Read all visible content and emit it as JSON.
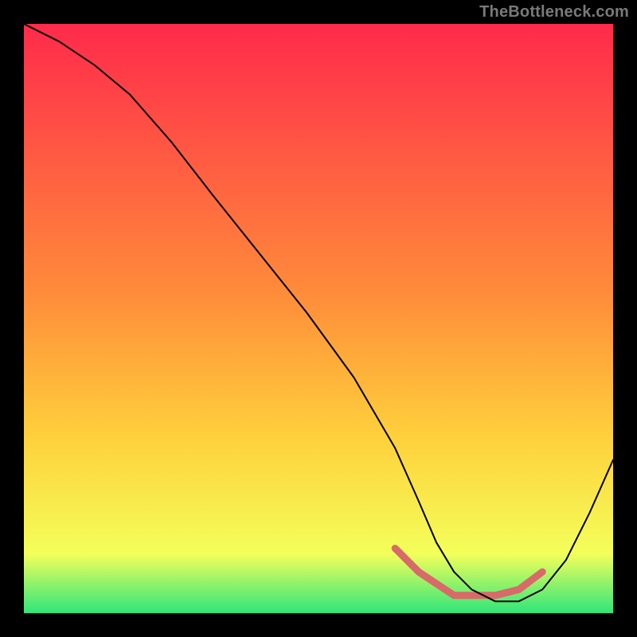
{
  "watermark": "TheBottleneck.com",
  "chart_data": {
    "type": "line",
    "title": "",
    "xlabel": "",
    "ylabel": "",
    "xlim": [
      0,
      100
    ],
    "ylim": [
      0,
      100
    ],
    "grid": false,
    "legend": false,
    "gradient": {
      "top_color": "#ff2a4b",
      "mid_color": "#ffd03b",
      "bottom_color": "#2fe67a"
    },
    "series": [
      {
        "name": "bottleneck-curve",
        "x": [
          0,
          6,
          12,
          18,
          25,
          32,
          40,
          48,
          56,
          63,
          67,
          70,
          73,
          76,
          80,
          84,
          88,
          92,
          96,
          100
        ],
        "y": [
          100,
          97,
          93,
          88,
          80,
          71,
          61,
          51,
          40,
          28,
          19,
          12,
          7,
          4,
          2,
          2,
          4,
          9,
          17,
          26
        ]
      }
    ],
    "highlight": {
      "name": "sweet-spot",
      "x": [
        63,
        67,
        70,
        73,
        76,
        80,
        84,
        88
      ],
      "y": [
        11,
        7,
        5,
        3,
        3,
        3,
        4,
        7
      ]
    }
  }
}
